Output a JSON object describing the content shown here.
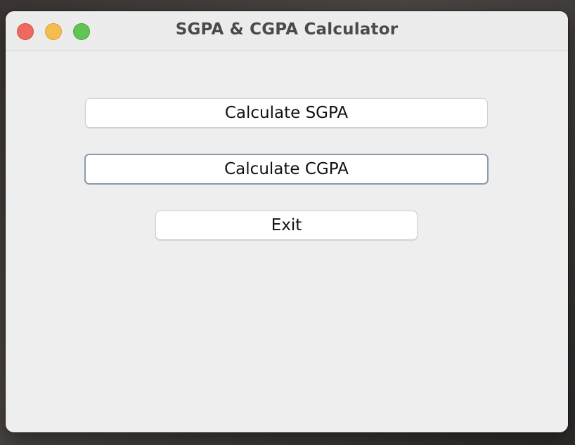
{
  "window": {
    "title": "SGPA & CGPA Calculator"
  },
  "buttons": {
    "sgpa_label": "Calculate SGPA",
    "cgpa_label": "Calculate CGPA",
    "exit_label": "Exit"
  },
  "colors": {
    "traffic_close": "#ee6a5f",
    "traffic_minimize": "#f5bd4f",
    "traffic_zoom": "#61c554",
    "focus_ring": "#8a9bb0"
  }
}
